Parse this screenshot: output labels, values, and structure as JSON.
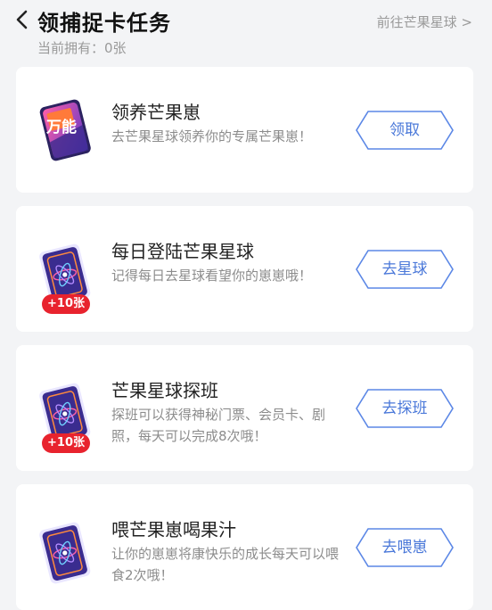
{
  "header": {
    "title": "领捕捉卡任务",
    "owned_text": "当前拥有：0张",
    "goto_link": "前往芒果星球 >"
  },
  "tasks": [
    {
      "title": "领养芒果崽",
      "desc": "去芒果星球领养你的专属芒果崽！",
      "button": "领取",
      "icon": "wanneng-card-icon",
      "icon_text": "万能",
      "badge": ""
    },
    {
      "title": "每日登陆芒果星球",
      "desc": "记得每日去星球看望你的崽崽哦！",
      "button": "去星球",
      "icon": "atom-card-icon",
      "icon_text": "",
      "badge": "+10张"
    },
    {
      "title": "芒果星球探班",
      "desc": "探班可以获得神秘门票、会员卡、剧照，每天可以完成8次哦！",
      "button": "去探班",
      "icon": "atom-card-icon",
      "icon_text": "",
      "badge": "+10张"
    },
    {
      "title": "喂芒果崽喝果汁",
      "desc": "让你的崽崽将康快乐的成长每天可以喂食2次哦！",
      "button": "去喂崽",
      "icon": "atom-card-icon",
      "icon_text": "",
      "badge": ""
    }
  ],
  "colors": {
    "accent": "#4a78d9",
    "badge": "#e8232e",
    "background": "#f3f4f6"
  }
}
